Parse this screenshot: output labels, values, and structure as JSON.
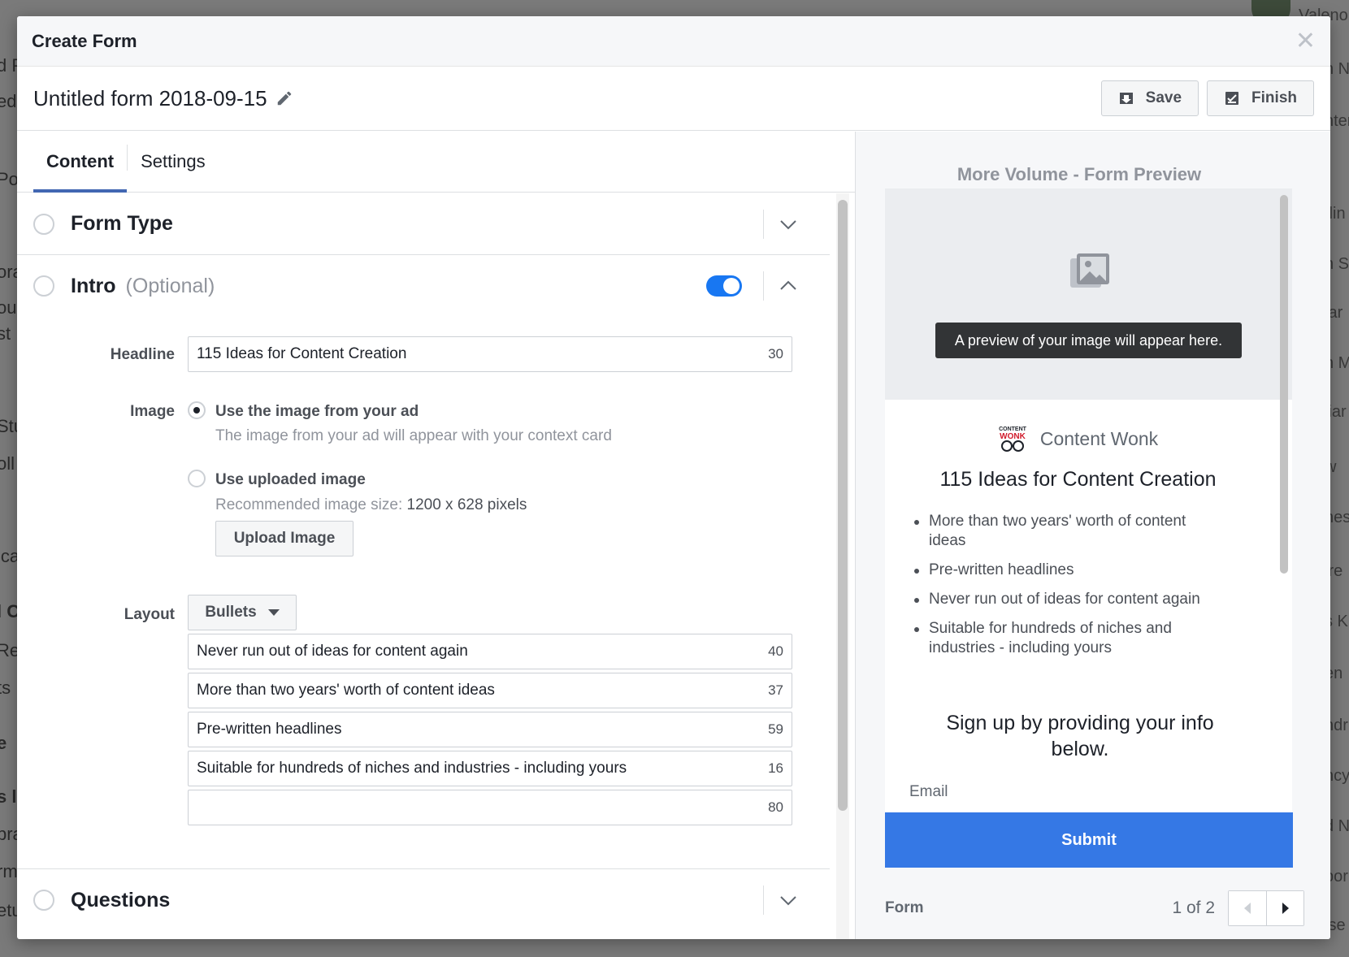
{
  "background": {
    "left_fragments": [
      "d P",
      "ed",
      "Po",
      "ora",
      "ou",
      "st",
      "Stu",
      "oll",
      "ica",
      "l C",
      "Re",
      "ts",
      "e",
      "s l",
      "bra",
      "rm",
      "etu"
    ],
    "top_right_name": "Valeno",
    "right_fragments": [
      "n N",
      "nter",
      "tlin",
      "n S",
      "liar",
      "n M",
      "iar",
      "w",
      "nes",
      "ire",
      "s K",
      "en",
      "ndr",
      "ncy",
      "d N",
      "por",
      "ise"
    ]
  },
  "modal": {
    "title": "Create Form",
    "close_icon": "close-icon"
  },
  "form_bar": {
    "form_name": "Untitled form 2018-09-15",
    "save_label": "Save",
    "finish_label": "Finish"
  },
  "tabs": [
    {
      "label": "Content",
      "active": true
    },
    {
      "label": "Settings",
      "active": false
    }
  ],
  "sections": {
    "form_type": {
      "title": "Form Type"
    },
    "intro": {
      "title": "Intro",
      "optional": "(Optional)",
      "enabled": true,
      "headline_label": "Headline",
      "headline_value": "115 Ideas for Content Creation",
      "headline_count": "30",
      "image_label": "Image",
      "image_options": [
        {
          "title": "Use the image from your ad",
          "desc": "The image from your ad will appear with your context card",
          "checked": true
        },
        {
          "title": "Use uploaded image",
          "desc_prefix": "Recommended image size:",
          "desc_value": "1200 x 628 pixels",
          "checked": false
        }
      ],
      "upload_label": "Upload Image",
      "layout_label": "Layout",
      "layout_value": "Bullets",
      "bullets": [
        {
          "value": "Never run out of ideas for content again",
          "count": "40"
        },
        {
          "value": "More than two years' worth of content ideas",
          "count": "37"
        },
        {
          "value": "Pre-written headlines",
          "count": "59"
        },
        {
          "value": "Suitable for hundreds of niches and industries - including yours",
          "count": "16"
        },
        {
          "value": "",
          "count": "80"
        }
      ]
    },
    "questions": {
      "title": "Questions"
    }
  },
  "preview": {
    "title": "More Volume - Form Preview",
    "image_note": "A preview of your image will appear here.",
    "brand_logo_text_top": "CONTENT",
    "brand_logo_text_bottom": "WONK",
    "brand_name": "Content Wonk",
    "headline": "115 Ideas for Content Creation",
    "bullets": [
      "More than two years' worth of content ideas",
      "Pre-written headlines",
      "Never run out of ideas for content again",
      "Suitable for hundreds of niches and industries - including yours"
    ],
    "signup_text": "Sign up by providing your info below.",
    "email_label": "Email",
    "submit_label": "Submit",
    "footer_label": "Form",
    "page_indicator": "1 of 2"
  },
  "colors": {
    "accent": "#4267b2",
    "toggle_on": "#1877f2",
    "submit_blue": "#3578e5"
  }
}
